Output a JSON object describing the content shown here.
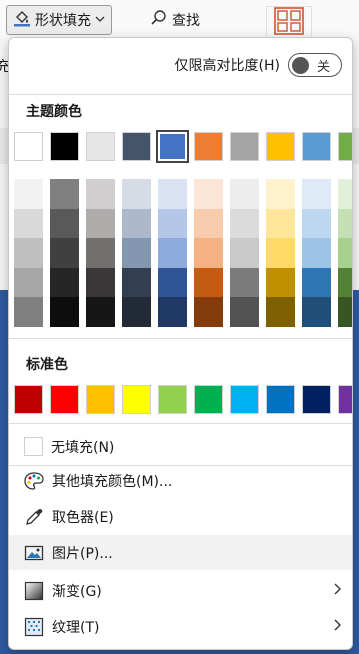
{
  "toolbar": {
    "shape_fill_label": "形状填充",
    "find_label": "查找",
    "edge_text": "充"
  },
  "menu": {
    "high_contrast_label": "仅限高对比度(H)",
    "toggle_state": "关",
    "theme_colors_title": "主题颜色",
    "theme_colors": [
      "#ffffff",
      "#000000",
      "#e7e6e6",
      "#44546a",
      "#4472c4",
      "#ed7d31",
      "#a5a5a5",
      "#ffc000",
      "#5b9bd5",
      "#70ad47"
    ],
    "selected_theme_index": 4,
    "shades": [
      [
        "#f2f2f2",
        "#d9d9d9",
        "#bfbfbf",
        "#a6a6a6",
        "#808080"
      ],
      [
        "#808080",
        "#595959",
        "#404040",
        "#262626",
        "#0d0d0d"
      ],
      [
        "#d0cece",
        "#aeabab",
        "#757070",
        "#3a3838",
        "#171616"
      ],
      [
        "#d6dce5",
        "#adb9ca",
        "#8497b0",
        "#333f50",
        "#222a35"
      ],
      [
        "#dae3f3",
        "#b4c7e7",
        "#8faadc",
        "#2f5597",
        "#203864"
      ],
      [
        "#fbe5d6",
        "#f8cbad",
        "#f4b183",
        "#c55a11",
        "#843c0c"
      ],
      [
        "#ededed",
        "#dbdbdb",
        "#c9c9c9",
        "#7b7b7b",
        "#525252"
      ],
      [
        "#fff2cc",
        "#ffe699",
        "#ffd966",
        "#bf9000",
        "#7f6000"
      ],
      [
        "#deebf7",
        "#bdd7ee",
        "#9dc3e6",
        "#2e75b6",
        "#1f4e79"
      ],
      [
        "#e2f0d9",
        "#c5e0b4",
        "#a9d18e",
        "#538135",
        "#375623"
      ]
    ],
    "standard_colors_title": "标准色",
    "standard_colors": [
      "#c00000",
      "#ff0000",
      "#ffc000",
      "#ffff00",
      "#92d050",
      "#00b050",
      "#00b0f0",
      "#0070c0",
      "#002060",
      "#7030a0"
    ],
    "no_fill_label": "无填充(N)",
    "more_colors_label": "其他填充颜色(M)...",
    "eyedropper_label": "取色器(E)",
    "picture_label": "图片(P)...",
    "gradient_label": "渐变(G)",
    "texture_label": "纹理(T)"
  }
}
